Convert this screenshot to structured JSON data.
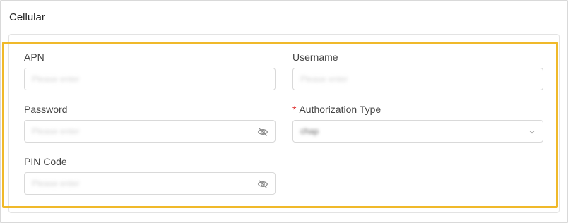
{
  "section": {
    "title": "Cellular"
  },
  "fields": {
    "apn": {
      "label": "APN",
      "placeholder": "Please enter"
    },
    "username": {
      "label": "Username",
      "placeholder": "Please enter"
    },
    "password": {
      "label": "Password",
      "placeholder": "Please enter",
      "icon": "eye-off-icon"
    },
    "auth_type": {
      "label": "Authorization Type",
      "required_mark": "*",
      "value": "chap",
      "icon": "chevron-down-icon"
    },
    "pin_code": {
      "label": "PIN Code",
      "placeholder": "Please enter",
      "icon": "eye-off-icon"
    }
  },
  "colors": {
    "highlight": "#f0b92a",
    "required": "#e03131"
  }
}
